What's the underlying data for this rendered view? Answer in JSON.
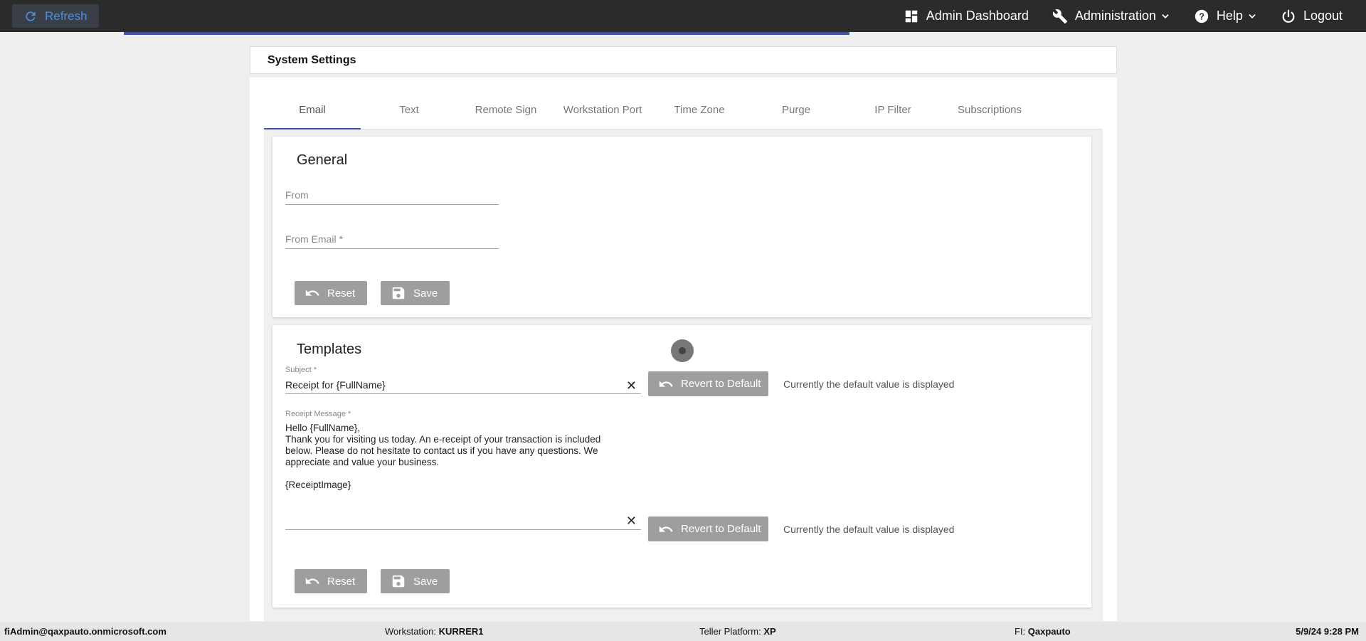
{
  "topbar": {
    "refresh_label": "Refresh",
    "nav": [
      {
        "label": "Admin Dashboard",
        "icon": "dashboard-icon"
      },
      {
        "label": "Administration",
        "icon": "wrench-icon",
        "dropdown": true
      },
      {
        "label": "Help",
        "icon": "help-icon",
        "dropdown": true
      },
      {
        "label": "Logout",
        "icon": "power-icon"
      }
    ],
    "accent_color": "#3f51b5"
  },
  "header": {
    "title": "System Settings"
  },
  "tabs": [
    "Email",
    "Text",
    "Remote Sign",
    "Workstation Port",
    "Time Zone",
    "Purge",
    "IP Filter",
    "Subscriptions"
  ],
  "active_tab": "Email",
  "general": {
    "title": "General",
    "from_placeholder": "From",
    "from_email_placeholder": "From Email *",
    "reset_label": "Reset",
    "save_label": "Save"
  },
  "templates": {
    "title": "Templates",
    "subject_label": "Subject *",
    "subject_value": "Receipt for {FullName}",
    "revert_label": "Revert to Default",
    "default_info": "Currently the default value is displayed",
    "message_label": "Receipt Message *",
    "message_value": "Hello {FullName},\nThank you for visiting us today. An e-receipt of your transaction is included below. Please do not hesitate to contact us if you have any questions. We appreciate and value your business.\n\n{ReceiptImage}",
    "reset_label": "Reset",
    "save_label": "Save"
  },
  "statusbar": {
    "user": "fiAdmin@qaxpauto.onmicrosoft.com",
    "workstation_label": "Workstation:",
    "workstation_value": "KURRER1",
    "platform_label": "Teller Platform:",
    "platform_value": "XP",
    "fi_label": "FI:",
    "fi_value": "Qaxpauto",
    "datetime": "5/9/24 9:28 PM"
  }
}
